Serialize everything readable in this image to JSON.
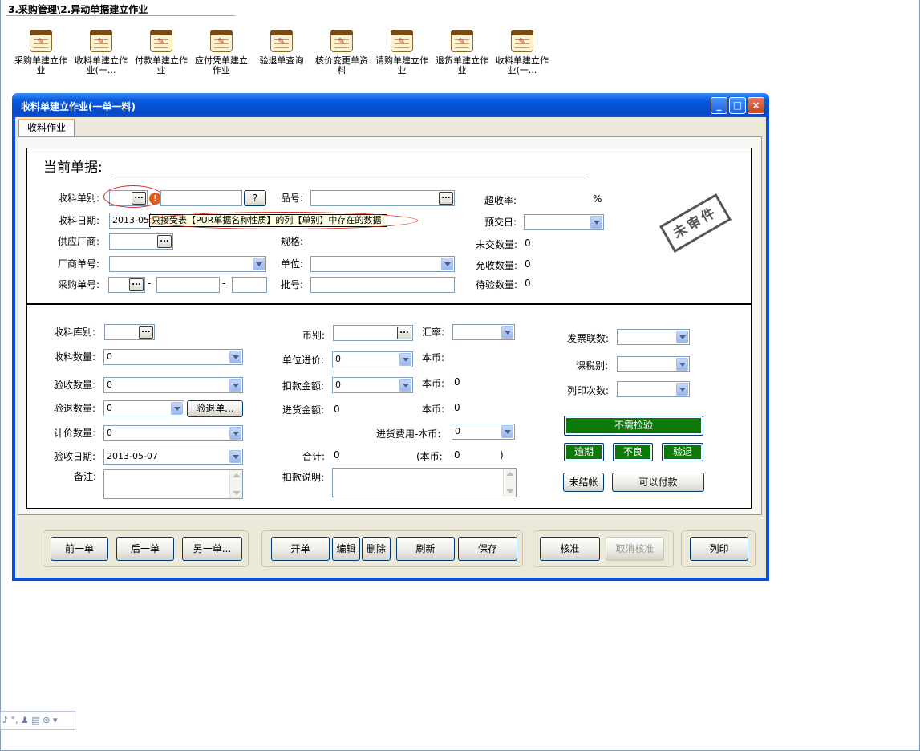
{
  "breadcrumb": "3.采购管理\\2.异动单据建立作业",
  "launcher": [
    {
      "label": "采购单建立作业"
    },
    {
      "label": "收料单建立作业(一..."
    },
    {
      "label": "付款单建立作业"
    },
    {
      "label": "应付凭单建立作业"
    },
    {
      "label": "验退单查询"
    },
    {
      "label": "核价变更单资料"
    },
    {
      "label": "请购单建立作业"
    },
    {
      "label": "退货单建立作业"
    },
    {
      "label": "收料单建立作业(一..."
    }
  ],
  "window": {
    "title": "收料单建立作业(一单一料)",
    "tab": "收料作业",
    "controls": {
      "minimize": "_",
      "maximize": "□",
      "close": "×"
    }
  },
  "header": {
    "section_title": "当前单据:",
    "doc_type_label": "收料单别:",
    "doc_type_value": "",
    "doc_no_value": "",
    "help_button": "?",
    "receive_date_label": "收料日期:",
    "receive_date_value": "2013-05-",
    "validation_tooltip": "只接受表【PUR单据名称性质】的列【单别】中存在的数据!",
    "supplier_label": "供应厂商:",
    "vendor_no_label": "厂商单号:",
    "po_no_label": "采购单号:",
    "po_sep1": "-",
    "po_sep2": "-",
    "item_no_label": "品号:",
    "spec_label": "规格:",
    "unit_label": "单位:",
    "batch_label": "批号:",
    "over_rate_label": "超收率:",
    "over_rate_unit": "%",
    "due_date_label": "预交日:",
    "unreceived_label": "未交数量:",
    "unreceived_value": "0",
    "allow_qty_label": "允收数量:",
    "allow_qty_value": "0",
    "pending_inspect_label": "待验数量:",
    "pending_inspect_value": "0",
    "stamp": "未审件"
  },
  "detail": {
    "warehouse_label": "收料库别:",
    "receive_qty_label": "收料数量:",
    "receive_qty_value": "0",
    "accept_qty_label": "验收数量:",
    "accept_qty_value": "0",
    "reject_qty_label": "验退数量:",
    "reject_qty_value": "0",
    "reject_button": "验退单...",
    "price_qty_label": "计价数量:",
    "price_qty_value": "0",
    "inspect_date_label": "验收日期:",
    "inspect_date_value": "2013-05-07",
    "remark_label": "备注:",
    "currency_label": "币别:",
    "rate_label": "汇率:",
    "unit_price_label": "单位进价:",
    "unit_price_value": "0",
    "local_currency_1": "本币:",
    "deduct_label": "扣款金额:",
    "deduct_value": "0",
    "local_currency_2": "本币:",
    "local_currency_2_value": "0",
    "purchase_amt_label": "进货金额:",
    "purchase_amt_value": "0",
    "local_currency_3": "本币:",
    "local_currency_3_value": "0",
    "purchase_fee_label": "进货费用-本币:",
    "purchase_fee_value": "0",
    "total_label": "合计:",
    "total_value": "0",
    "total_local_label": "(本币:",
    "total_local_value": "0",
    "total_local_close": ")",
    "deduct_note_label": "扣款说明:",
    "invoice_copies_label": "发票联数:",
    "tax_type_label": "课税别:",
    "print_count_label": "列印次数:",
    "no_inspect_button": "不需检验",
    "overdue_button": "逾期",
    "defect_button": "不良",
    "reject_check_button": "验退",
    "unsettled_button": "未结帐",
    "payable_button": "可以付款"
  },
  "footer": {
    "prev": "前一单",
    "next": "后一单",
    "other": "另一单...",
    "open": "开单",
    "edit": "编辑",
    "delete": "删除",
    "refresh": "刷新",
    "save": "保存",
    "approve": "核准",
    "cancel_approve": "取消核准",
    "print": "列印"
  },
  "taskbar": {
    "tray": "♪ °, ♟ ▤ ⊛ ▾"
  }
}
